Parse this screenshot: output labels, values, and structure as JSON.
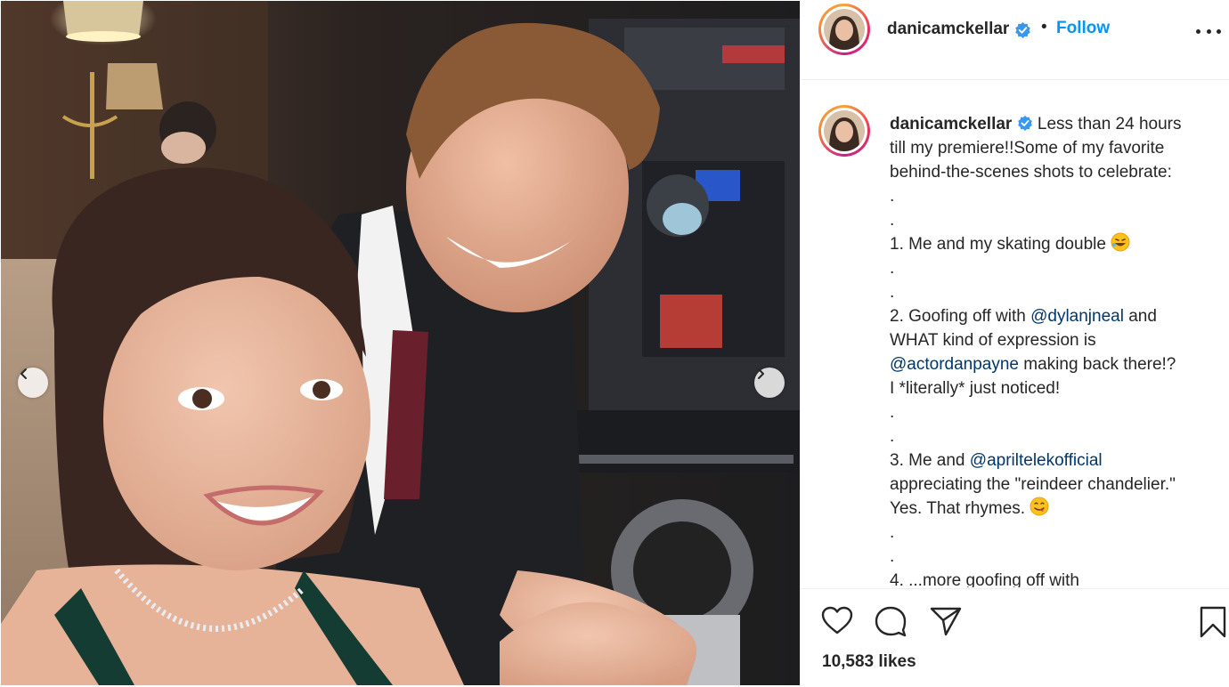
{
  "post": {
    "username": "danicamckellar",
    "follow_label": "Follow",
    "separator": "•",
    "caption_lines": [
      "Less than 24 hours",
      "till my premiere!!Some of my favorite",
      "behind-the-scenes shots to celebrate:",
      ".",
      ".",
      "1. Me and my skating double",
      ".",
      ".",
      "2. Goofing off with",
      "@dylanjneal",
      "and",
      "WHAT kind of expression is",
      "@actordanpayne",
      "making back there!?",
      "I *literally* just noticed!",
      ".",
      ".",
      "3. Me and",
      "@apriltelekofficial",
      "appreciating the \"reindeer chandelier.\"",
      "Yes. That rhymes.",
      ".",
      ".",
      "4. ...more goofing off with"
    ],
    "likes": "10,583 likes"
  },
  "icons": {
    "verified": "verified-badge-icon",
    "more": "more-options-icon",
    "like": "heart-icon",
    "comment": "comment-icon",
    "share": "paper-plane-icon",
    "save": "bookmark-icon",
    "prev": "chevron-left-icon",
    "next": "chevron-right-icon"
  },
  "colors": {
    "accent": "#0095f6",
    "mention": "#00376b",
    "text": "#262626",
    "verified": "#3897f0"
  }
}
